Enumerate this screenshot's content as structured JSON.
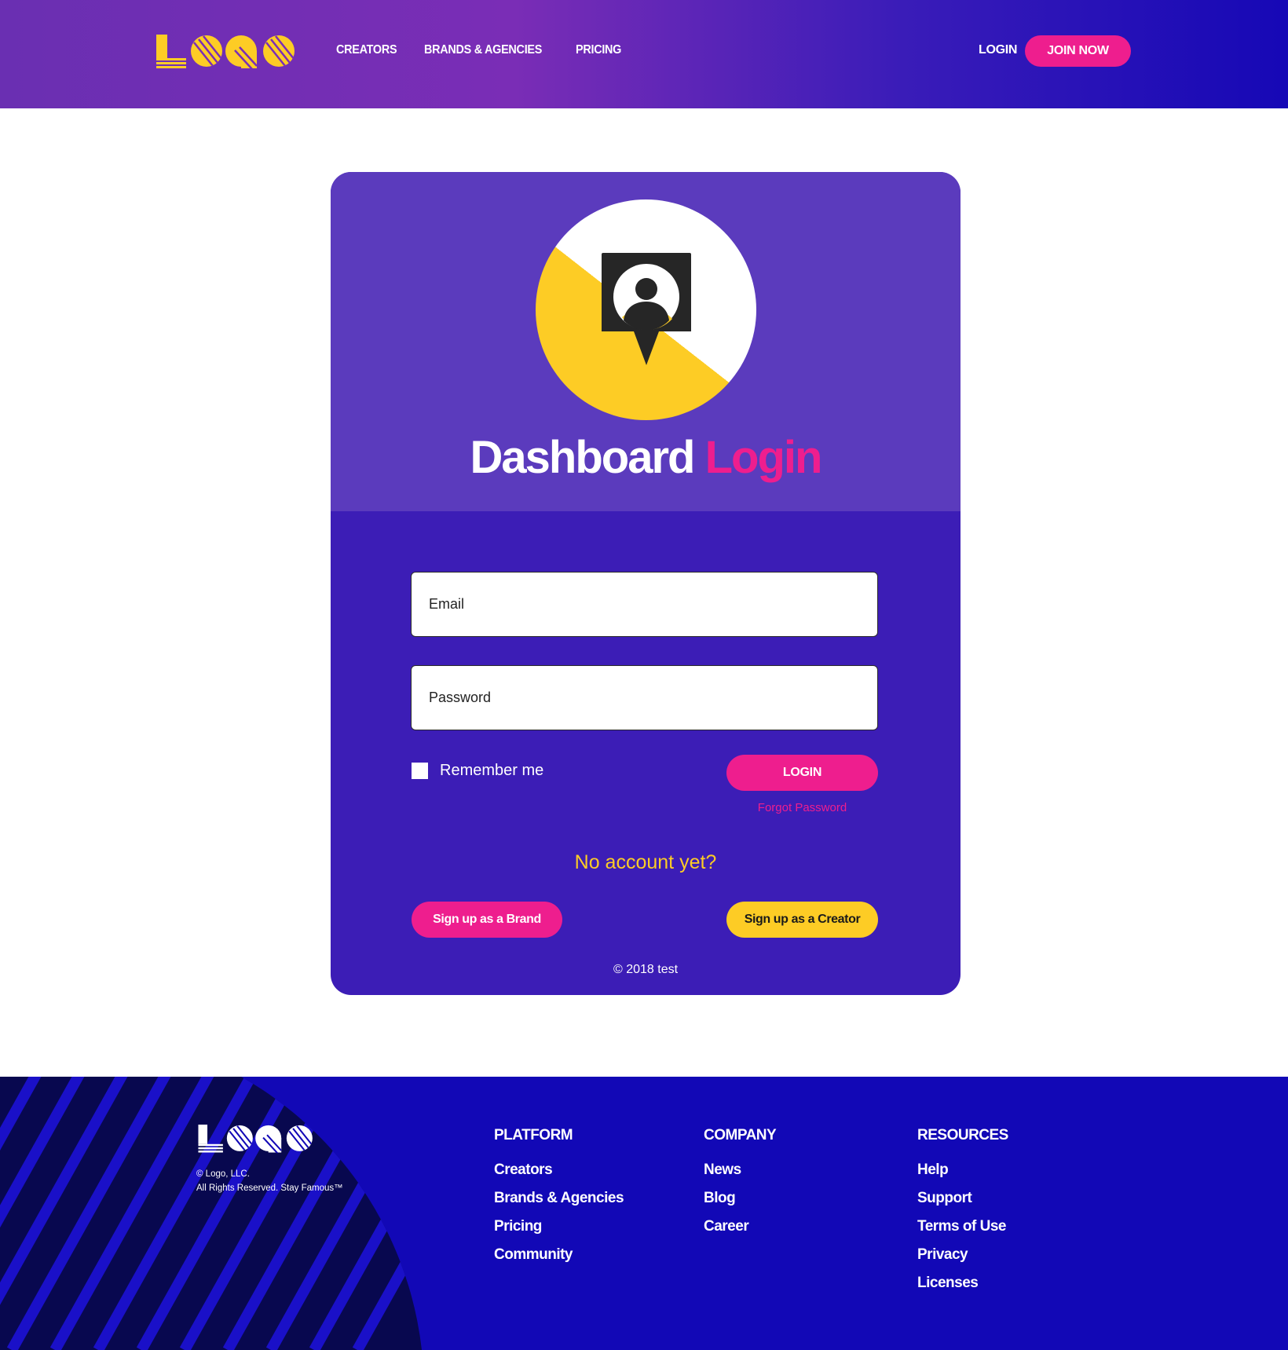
{
  "header": {
    "logo_text": "LOGO",
    "nav": [
      "CREATORS",
      "BRANDS & AGENCIES",
      "PRICING"
    ],
    "login_label": "LOGIN",
    "join_label": "JOIN NOW"
  },
  "card": {
    "title_part1": "Dashboard",
    "title_part2": "Login",
    "email_placeholder": "Email",
    "password_placeholder": "Password",
    "remember_label": "Remember me",
    "login_label": "LOGIN",
    "forgot_label": "Forgot Password",
    "no_account": "No account yet?",
    "signup_brand": "Sign up as a Brand",
    "signup_creator": "Sign up as a Creator",
    "copyright": "© 2018 test"
  },
  "footer": {
    "logo_text": "LOGO",
    "legal_line1": "© Logo, LLC.",
    "legal_line2": "All Rights Reserved. Stay Famous™",
    "columns": [
      {
        "title": "PLATFORM",
        "links": [
          "Creators",
          "Brands & Agencies",
          "Pricing",
          "Community"
        ]
      },
      {
        "title": "COMPANY",
        "links": [
          "News",
          "Blog",
          "Career"
        ]
      },
      {
        "title": "RESOURCES",
        "links": [
          "Help",
          "Support",
          "Terms of Use",
          "Privacy",
          "Licenses"
        ]
      }
    ]
  },
  "colors": {
    "pink": "#ee1e8e",
    "yellow": "#fdcc25",
    "card_top": "#5b3bbd",
    "card_bottom": "#3c1db6",
    "footer_bg": "#1208b6"
  }
}
